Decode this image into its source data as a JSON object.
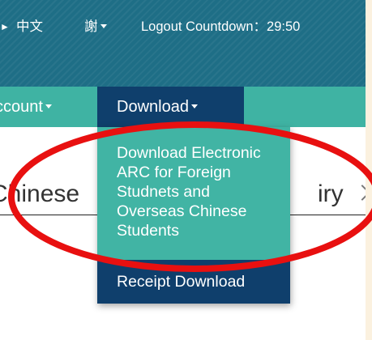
{
  "topbar": {
    "language": "中文",
    "user": "謝",
    "logout_label": "Logout Countdown：29:50"
  },
  "nav": {
    "account_label": "ccount",
    "download_label": "Download"
  },
  "dropdown": {
    "items": [
      {
        "label_lines": [
          "Download Electronic",
          "ARC for Foreign",
          "Studnets and",
          "Overseas Chinese",
          "Students"
        ]
      },
      {
        "label": "Receipt Download"
      }
    ]
  },
  "content": {
    "tab_left": "Chinese",
    "tab_right": "iry"
  },
  "colors": {
    "topbar": "#1e6e86",
    "navbar": "#3fb3a3",
    "active_nav": "#0f3f6c",
    "annotation": "#e81010"
  }
}
